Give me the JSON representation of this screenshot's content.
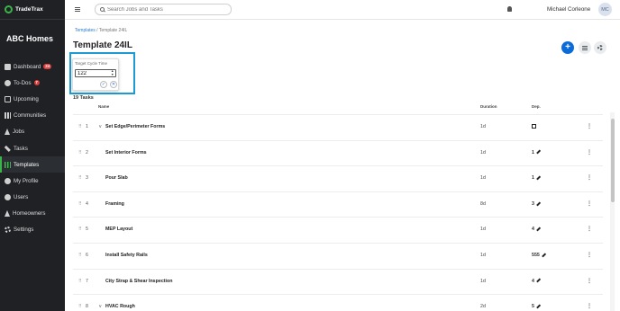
{
  "brand": {
    "name": "TradeTrax"
  },
  "sidebar": {
    "org_name": "ABC Homes",
    "items": [
      {
        "label": "Dashboard",
        "icon": "dashboard-icon",
        "badge": "24"
      },
      {
        "label": "To-Dos",
        "icon": "todo-icon",
        "badge": "7"
      },
      {
        "label": "Upcoming",
        "icon": "calendar-icon"
      },
      {
        "label": "Communities",
        "icon": "communities-icon"
      },
      {
        "label": "Jobs",
        "icon": "home-icon"
      },
      {
        "label": "Tasks",
        "icon": "wrench-icon"
      },
      {
        "label": "Templates",
        "icon": "templates-icon",
        "active": true
      },
      {
        "label": "My Profile",
        "icon": "profile-icon"
      },
      {
        "label": "Users",
        "icon": "users-icon"
      },
      {
        "label": "Homeowners",
        "icon": "homeowners-icon"
      },
      {
        "label": "Settings",
        "icon": "settings-icon"
      }
    ]
  },
  "topbar": {
    "search_placeholder": "Search Jobs and Tasks",
    "user_name": "Michael Corleone",
    "avatar_initials": "MC"
  },
  "breadcrumb": {
    "parent": "Templates",
    "separator": " / ",
    "current": "Template 24IL"
  },
  "page": {
    "title": "Template 24IL",
    "add_label": "+"
  },
  "cycle_time": {
    "label": "Target Cycle Time",
    "value": "122",
    "confirm": "✓",
    "cancel": "✕"
  },
  "tasks": {
    "count_label": "19 Tasks",
    "columns": {
      "name": "Name",
      "duration": "Duration",
      "dep": "Dep."
    },
    "rows": [
      {
        "num": "1",
        "caret": "v",
        "name": "Set Edge/Perimeter Forms",
        "duration": "1d",
        "dep": ""
      },
      {
        "num": "2",
        "caret": "",
        "name": "Set Interior Forms",
        "duration": "1d",
        "dep": "1"
      },
      {
        "num": "3",
        "caret": "",
        "name": "Pour Slab",
        "duration": "1d",
        "dep": "1"
      },
      {
        "num": "4",
        "caret": "",
        "name": "Framing",
        "duration": "8d",
        "dep": "3"
      },
      {
        "num": "5",
        "caret": "",
        "name": "MEP Layout",
        "duration": "1d",
        "dep": "4"
      },
      {
        "num": "6",
        "caret": "",
        "name": "Install Safety Rails",
        "duration": "1d",
        "dep": "555"
      },
      {
        "num": "7",
        "caret": "",
        "name": "City Strap & Shear Inspection",
        "duration": "1d",
        "dep": "4"
      },
      {
        "num": "8",
        "caret": "v",
        "name": "HVAC Rough",
        "duration": "2d",
        "dep": "5"
      }
    ]
  }
}
